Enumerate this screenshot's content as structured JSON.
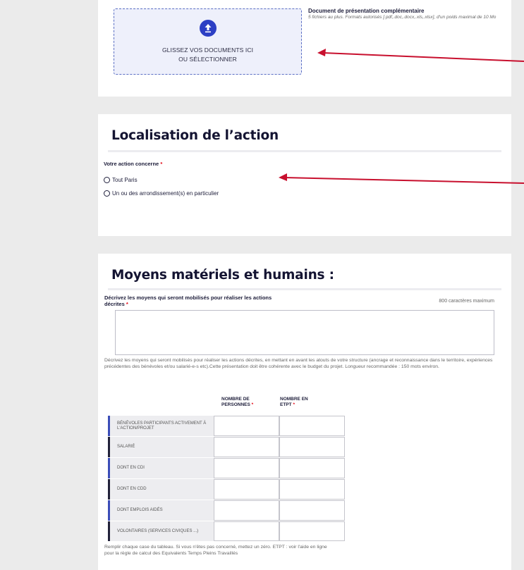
{
  "upload": {
    "line1": "GLISSEZ VOS DOCUMENTS ICI",
    "line2": "OU SÉLECTIONNER",
    "doc_title": "Document de présentation complémentaire",
    "doc_hint": "5 fichiers au plus. Formats autorisés [.pdf,.doc,.docx,.xls,.xlsx], d'un poids maximal de 10 Mo",
    "icon": "upload-arrow-icon"
  },
  "localisation": {
    "title": "Localisation de l’action",
    "label": "Votre action concerne",
    "required_mark": "*",
    "options": [
      "Tout Paris",
      "Un ou des arrondissement(s) en particulier"
    ]
  },
  "moyens": {
    "title": "Moyens matériels et humains :",
    "desc_label": "Décrivez les moyens qui seront mobilisés pour réaliser les actions décrites",
    "required_mark": "*",
    "max_chars": "800 caractères maximum",
    "textarea_value": "",
    "help_text": "Décrivez les moyens qui seront mobilisés pour réaliser les actions décrites, en mettant en avant les atouts de votre structure (ancrage et reconnaissance dans le territoire, expériences précédentes des bénévoles et/ou salarié-e-s etc).Cette présentation doit être cohérente avec le budget du projet. Longueur recommandée : 150 mots environ.",
    "table": {
      "col1": "NOMBRE DE PERSONNES",
      "col2": "NOMBRE EN ETPT",
      "rows": [
        "BÉNÉVOLES PARTICIPANTS ACTIVEMENT À L'ACTION/PROJET",
        "SALARIÉ",
        "DONT EN CDI",
        "DONT EN CDD",
        "DONT EMPLOIS AIDÉS",
        "VOLONTAIRES (SERVICES CIVIQUES ...)"
      ]
    },
    "footer": "Remplir chaque case du tableau. Si vous n'êtes pas concerné, mettez un zéro. ETPT : voir l'aide en ligne pour la règle de calcul des Equivalents Temps Pleins Travaillés"
  },
  "colors": {
    "accent": "#2c3fc4",
    "arrow": "#c8102e",
    "required": "#e1000f",
    "title": "#141432"
  }
}
